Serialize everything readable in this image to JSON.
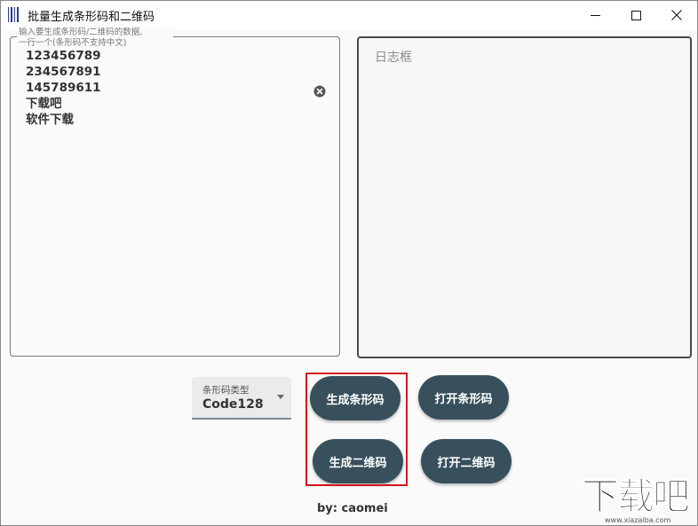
{
  "window": {
    "title": "批量生成条形码和二维码"
  },
  "input_panel": {
    "legend": "输入要生成条形码/二维码的数据,\n一行一个(条形码不支持中文)",
    "lines": [
      "123456789",
      "234567891",
      "145789611",
      "下载吧",
      "软件下载"
    ]
  },
  "log_panel": {
    "placeholder": "日志框"
  },
  "barcode_type": {
    "label": "条形码类型",
    "value": "Code128"
  },
  "buttons": {
    "generate_barcode": "生成条形码",
    "open_barcode": "打开条形码",
    "generate_qrcode": "生成二维码",
    "open_qrcode": "打开二维码"
  },
  "footer": {
    "credit": "by: caomei"
  },
  "watermark": {
    "logo": "下载吧",
    "url": "www.xiazaiba.com"
  },
  "colors": {
    "button_bg": "#37505c",
    "highlight": "#d4141c"
  }
}
